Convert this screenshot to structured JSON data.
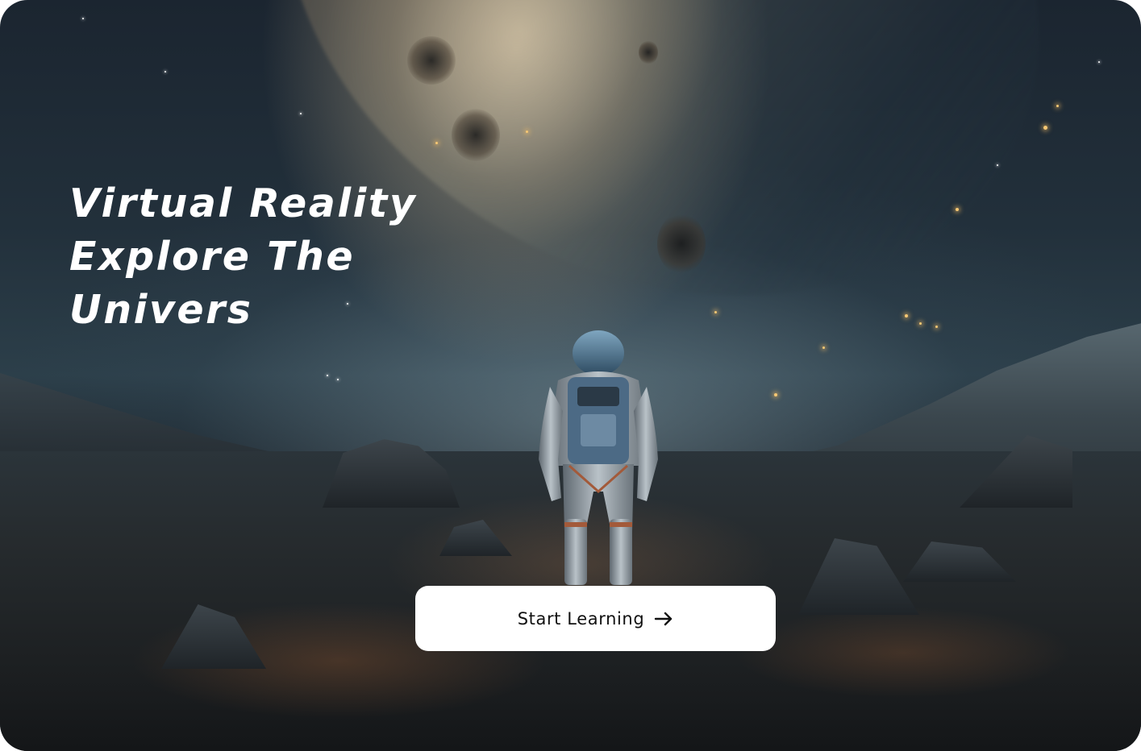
{
  "hero": {
    "headline_lines": [
      "Virtual Reality",
      "Explore The",
      "Univers"
    ],
    "background_image": "astronaut-on-alien-planet",
    "text_color": "#ffffff"
  },
  "cta": {
    "label": "Start Learning",
    "icon": "arrow-right-icon",
    "background": "#ffffff",
    "text_color": "#111111"
  }
}
